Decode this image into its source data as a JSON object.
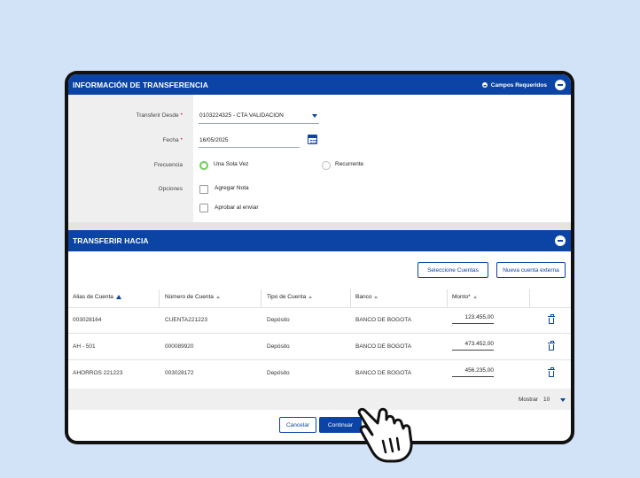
{
  "from_section": {
    "title": "INFORMACIÓN DE TRANSFERENCIA",
    "required_label": "Campos Requeridos",
    "transfer_from_label": "Transferir Desde",
    "transfer_from_value": "0103224325 - CTA VALIDACION",
    "date_label": "Fecha",
    "date_value": "16/05/2025",
    "frequency_label": "Frecuencia",
    "frequency_options": [
      "Una Sola Vez",
      "Recurrente"
    ],
    "frequency_selected": "Una Sola Vez",
    "options_label": "Opciones",
    "option_add_note": "Agregar Nota",
    "option_approve": "Aprobar al enviar",
    "required_mark": "*"
  },
  "to_section": {
    "title": "TRANSFERIR HACIA",
    "select_accounts_button": "Seleccione Cuentas",
    "new_external_button": "Nueva cuenta externa",
    "columns": [
      "Alias de Cuenta",
      "Número de Cuenta",
      "Tipo de Cuenta",
      "Banco",
      "Monto*"
    ],
    "rows": [
      {
        "alias": "003028164",
        "number": "CUENTA221223",
        "type": "Depósito",
        "bank": "BANCO DE BOGOTA",
        "amount": "123.455,00"
      },
      {
        "alias": "AH - 501",
        "number": "000089920",
        "type": "Depósito",
        "bank": "BANCO DE BOGOTA",
        "amount": "473.452,00"
      },
      {
        "alias": "AHORROS 221223",
        "number": "003028172",
        "type": "Depósito",
        "bank": "BANCO DE BOGOTA",
        "amount": "456.235,00"
      }
    ],
    "show_label": "Mostrar",
    "show_value": "10"
  },
  "actions": {
    "cancel_button": "Cancelar",
    "continue_button": "Continuar"
  },
  "colors": {
    "primary": "#0b44a4",
    "radio_selected": "#6ccf55",
    "background": "#d3e3f7"
  },
  "icons": [
    "chevron-down-icon",
    "collapse-icon",
    "calendar-icon",
    "sort-up-icon",
    "trash-icon",
    "hand-pointer-icon"
  ]
}
